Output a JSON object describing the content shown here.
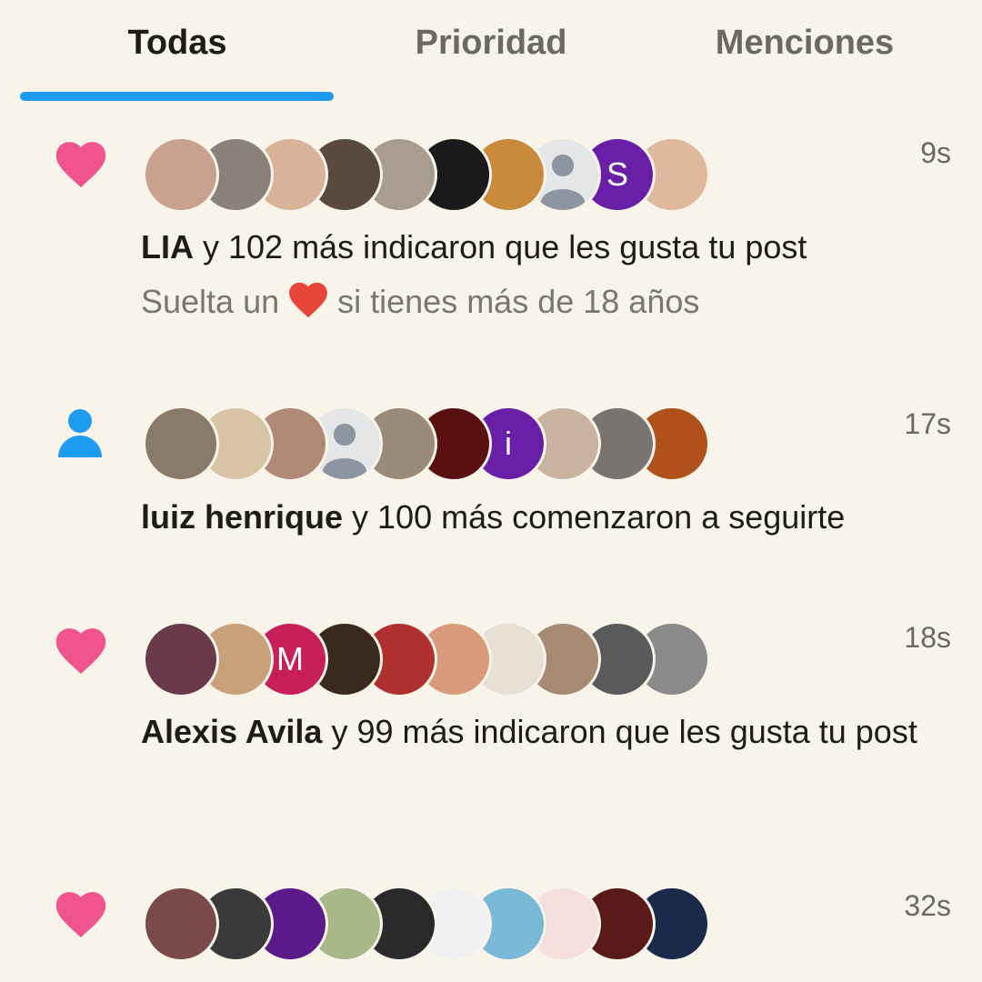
{
  "tabs": [
    {
      "label": "Todas",
      "active": true
    },
    {
      "label": "Prioridad",
      "active": false
    },
    {
      "label": "Menciones",
      "active": false
    }
  ],
  "colors": {
    "accent": "#1d9bf0",
    "like": "#f0548c",
    "follow": "#1d9bf0",
    "background": "#f8f4ea"
  },
  "notifications": [
    {
      "type": "like",
      "icon": "heart-icon",
      "time": "9s",
      "actor": "LIA",
      "rest": " y 102 más indicaron que les gusta tu post",
      "sub_before": "Suelta un ",
      "sub_emoji": "red-heart-emoji",
      "sub_after": " si tienes más de 18 años",
      "avatars": [
        {
          "color": "#c9a28f"
        },
        {
          "color": "#8a8178"
        },
        {
          "color": "#d8b39a"
        },
        {
          "color": "#5a4a3e"
        },
        {
          "color": "#a89c8f"
        },
        {
          "color": "#1a1a1a"
        },
        {
          "color": "#c98a3a"
        },
        {
          "color": "#e4e6e8",
          "placeholder": true
        },
        {
          "color": "#6a1fa8",
          "letter": "S"
        },
        {
          "color": "#e0b89e"
        }
      ]
    },
    {
      "type": "follow",
      "icon": "person-icon",
      "time": "17s",
      "actor": "luiz henrique",
      "rest": " y 100 más comenzaron a seguirte",
      "avatars": [
        {
          "color": "#8a7a6a"
        },
        {
          "color": "#d9c3a5"
        },
        {
          "color": "#b08a74"
        },
        {
          "color": "#e4e6e8",
          "placeholder": true
        },
        {
          "color": "#9a8a7a"
        },
        {
          "color": "#5a1010"
        },
        {
          "color": "#6a1fa8",
          "letter": "i"
        },
        {
          "color": "#c9b3a0"
        },
        {
          "color": "#7a7470"
        },
        {
          "color": "#b0501a"
        }
      ]
    },
    {
      "type": "like",
      "icon": "heart-icon",
      "time": "18s",
      "actor": "Alexis Avila",
      "rest": " y 99 más indicaron que les gusta tu post",
      "avatars": [
        {
          "color": "#6a3a4a"
        },
        {
          "color": "#c8a07a"
        },
        {
          "color": "#c81e5a",
          "letter": "M"
        },
        {
          "color": "#3a2a1e"
        },
        {
          "color": "#b03030"
        },
        {
          "color": "#d89a7a"
        },
        {
          "color": "#e8e0d4"
        },
        {
          "color": "#a88a72"
        },
        {
          "color": "#5a5a5a"
        },
        {
          "color": "#8a8a8a"
        }
      ]
    },
    {
      "type": "like",
      "icon": "heart-icon",
      "time": "32s",
      "avatars": [
        {
          "color": "#7a4a4a"
        },
        {
          "color": "#3a3a3a"
        },
        {
          "color": "#5a1a8a"
        },
        {
          "color": "#a8b888"
        },
        {
          "color": "#2a2a2a"
        },
        {
          "color": "#f0f0f0"
        },
        {
          "color": "#7ab8d8"
        },
        {
          "color": "#f4dede"
        },
        {
          "color": "#5a1a1a"
        },
        {
          "color": "#1a2a4a"
        }
      ]
    }
  ]
}
